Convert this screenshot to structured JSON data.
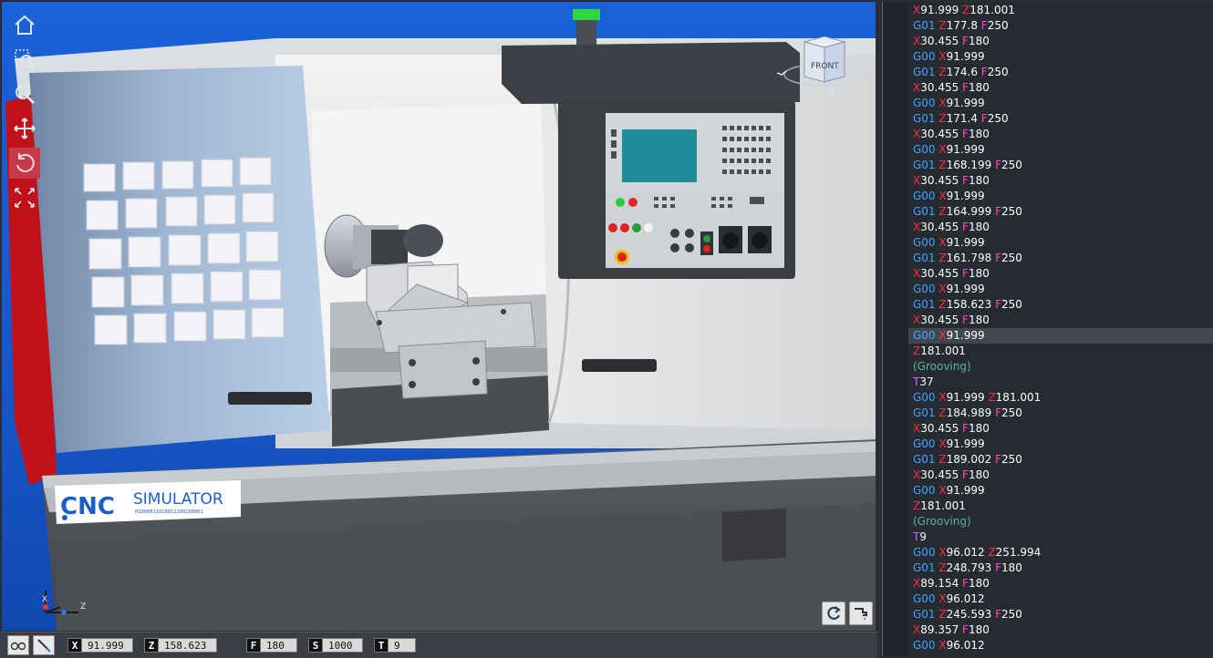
{
  "viewport": {
    "logo": {
      "brand": "CNC",
      "word": "SIMULATOR",
      "binary": "01000011010011100100001"
    },
    "view_cube_label": "FRONT",
    "view_cube_compass": "S",
    "axis_triad": {
      "x": "X",
      "z": "Z"
    }
  },
  "view_toolbar": [
    "home-icon",
    "zoom-window-icon",
    "zoom-icon",
    "pan-icon",
    "rotate-icon",
    "fit-icon"
  ],
  "viewport_buttons": [
    "reset-rotation-icon",
    "coolant-icon"
  ],
  "status": {
    "x_label": "X",
    "x_value": "91.999",
    "z_label": "Z",
    "z_value": "158.623",
    "f_label": "F",
    "f_value": "180",
    "s_label": "S",
    "s_value": "1000",
    "t_label": "T",
    "t_value": "9"
  },
  "program": [
    [
      [
        "X",
        "X"
      ],
      [
        "num",
        "91.999 "
      ],
      [
        "Z",
        "Z"
      ],
      [
        "num",
        "181.001"
      ]
    ],
    [
      [
        "G",
        "G01 "
      ],
      [
        "Z",
        "Z"
      ],
      [
        "num",
        "177.8 "
      ],
      [
        "F",
        "F"
      ],
      [
        "num",
        "250"
      ]
    ],
    [
      [
        "X",
        "X"
      ],
      [
        "num",
        "30.455 "
      ],
      [
        "F",
        "F"
      ],
      [
        "num",
        "180"
      ]
    ],
    [
      [
        "G",
        "G00 "
      ],
      [
        "X",
        "X"
      ],
      [
        "num",
        "91.999"
      ]
    ],
    [
      [
        "G",
        "G01 "
      ],
      [
        "Z",
        "Z"
      ],
      [
        "num",
        "174.6 "
      ],
      [
        "F",
        "F"
      ],
      [
        "num",
        "250"
      ]
    ],
    [
      [
        "X",
        "X"
      ],
      [
        "num",
        "30.455 "
      ],
      [
        "F",
        "F"
      ],
      [
        "num",
        "180"
      ]
    ],
    [
      [
        "G",
        "G00 "
      ],
      [
        "X",
        "X"
      ],
      [
        "num",
        "91.999"
      ]
    ],
    [
      [
        "G",
        "G01 "
      ],
      [
        "Z",
        "Z"
      ],
      [
        "num",
        "171.4 "
      ],
      [
        "F",
        "F"
      ],
      [
        "num",
        "250"
      ]
    ],
    [
      [
        "X",
        "X"
      ],
      [
        "num",
        "30.455 "
      ],
      [
        "F",
        "F"
      ],
      [
        "num",
        "180"
      ]
    ],
    [
      [
        "G",
        "G00 "
      ],
      [
        "X",
        "X"
      ],
      [
        "num",
        "91.999"
      ]
    ],
    [
      [
        "G",
        "G01 "
      ],
      [
        "Z",
        "Z"
      ],
      [
        "num",
        "168.199 "
      ],
      [
        "F",
        "F"
      ],
      [
        "num",
        "250"
      ]
    ],
    [
      [
        "X",
        "X"
      ],
      [
        "num",
        "30.455 "
      ],
      [
        "F",
        "F"
      ],
      [
        "num",
        "180"
      ]
    ],
    [
      [
        "G",
        "G00 "
      ],
      [
        "X",
        "X"
      ],
      [
        "num",
        "91.999"
      ]
    ],
    [
      [
        "G",
        "G01 "
      ],
      [
        "Z",
        "Z"
      ],
      [
        "num",
        "164.999 "
      ],
      [
        "F",
        "F"
      ],
      [
        "num",
        "250"
      ]
    ],
    [
      [
        "X",
        "X"
      ],
      [
        "num",
        "30.455 "
      ],
      [
        "F",
        "F"
      ],
      [
        "num",
        "180"
      ]
    ],
    [
      [
        "G",
        "G00 "
      ],
      [
        "X",
        "X"
      ],
      [
        "num",
        "91.999"
      ]
    ],
    [
      [
        "G",
        "G01 "
      ],
      [
        "Z",
        "Z"
      ],
      [
        "num",
        "161.798 "
      ],
      [
        "F",
        "F"
      ],
      [
        "num",
        "250"
      ]
    ],
    [
      [
        "X",
        "X"
      ],
      [
        "num",
        "30.455 "
      ],
      [
        "F",
        "F"
      ],
      [
        "num",
        "180"
      ]
    ],
    [
      [
        "G",
        "G00 "
      ],
      [
        "X",
        "X"
      ],
      [
        "num",
        "91.999"
      ]
    ],
    [
      [
        "G",
        "G01 "
      ],
      [
        "Z",
        "Z"
      ],
      [
        "num",
        "158.623 "
      ],
      [
        "F",
        "F"
      ],
      [
        "num",
        "250"
      ]
    ],
    [
      [
        "X",
        "X"
      ],
      [
        "num",
        "30.455 "
      ],
      [
        "F",
        "F"
      ],
      [
        "num",
        "180"
      ]
    ],
    [
      [
        "G",
        "G00 "
      ],
      [
        "X",
        "X"
      ],
      [
        "num",
        "91.999"
      ]
    ],
    [
      [
        "Z",
        "Z"
      ],
      [
        "num",
        "181.001"
      ]
    ],
    [
      [
        "comment",
        "(Grooving)"
      ]
    ],
    [
      [
        "T",
        "T"
      ],
      [
        "num",
        "37"
      ]
    ],
    [
      [
        "G",
        "G00 "
      ],
      [
        "X",
        "X"
      ],
      [
        "num",
        "91.999 "
      ],
      [
        "Z",
        "Z"
      ],
      [
        "num",
        "181.001"
      ]
    ],
    [
      [
        "G",
        "G01 "
      ],
      [
        "Z",
        "Z"
      ],
      [
        "num",
        "184.989 "
      ],
      [
        "F",
        "F"
      ],
      [
        "num",
        "250"
      ]
    ],
    [
      [
        "X",
        "X"
      ],
      [
        "num",
        "30.455 "
      ],
      [
        "F",
        "F"
      ],
      [
        "num",
        "180"
      ]
    ],
    [
      [
        "G",
        "G00 "
      ],
      [
        "X",
        "X"
      ],
      [
        "num",
        "91.999"
      ]
    ],
    [
      [
        "G",
        "G01 "
      ],
      [
        "Z",
        "Z"
      ],
      [
        "num",
        "189.002 "
      ],
      [
        "F",
        "F"
      ],
      [
        "num",
        "250"
      ]
    ],
    [
      [
        "X",
        "X"
      ],
      [
        "num",
        "30.455 "
      ],
      [
        "F",
        "F"
      ],
      [
        "num",
        "180"
      ]
    ],
    [
      [
        "G",
        "G00 "
      ],
      [
        "X",
        "X"
      ],
      [
        "num",
        "91.999"
      ]
    ],
    [
      [
        "Z",
        "Z"
      ],
      [
        "num",
        "181.001"
      ]
    ],
    [
      [
        "comment",
        "(Grooving)"
      ]
    ],
    [
      [
        "T",
        "T"
      ],
      [
        "num",
        "9"
      ]
    ],
    [
      [
        "G",
        "G00 "
      ],
      [
        "X",
        "X"
      ],
      [
        "num",
        "96.012 "
      ],
      [
        "Z",
        "Z"
      ],
      [
        "num",
        "251.994"
      ]
    ],
    [
      [
        "G",
        "G01 "
      ],
      [
        "Z",
        "Z"
      ],
      [
        "num",
        "248.793 "
      ],
      [
        "F",
        "F"
      ],
      [
        "num",
        "180"
      ]
    ],
    [
      [
        "X",
        "X"
      ],
      [
        "num",
        "89.154 "
      ],
      [
        "F",
        "F"
      ],
      [
        "num",
        "180"
      ]
    ],
    [
      [
        "G",
        "G00 "
      ],
      [
        "X",
        "X"
      ],
      [
        "num",
        "96.012"
      ]
    ],
    [
      [
        "G",
        "G01 "
      ],
      [
        "Z",
        "Z"
      ],
      [
        "num",
        "245.593 "
      ],
      [
        "F",
        "F"
      ],
      [
        "num",
        "250"
      ]
    ],
    [
      [
        "X",
        "X"
      ],
      [
        "num",
        "89.357 "
      ],
      [
        "F",
        "F"
      ],
      [
        "num",
        "180"
      ]
    ],
    [
      [
        "G",
        "G00 "
      ],
      [
        "X",
        "X"
      ],
      [
        "num",
        "96.012"
      ]
    ]
  ],
  "active_line": 21,
  "colors": {
    "viewport_bg": "#1a60d8",
    "code_bg": "#262a31",
    "gcode": "#3fa4ff",
    "axis_word": "#ff2d3a",
    "feed_word": "#ff46c8",
    "tool_word": "#c66bff",
    "comment": "#5ab4a2"
  }
}
